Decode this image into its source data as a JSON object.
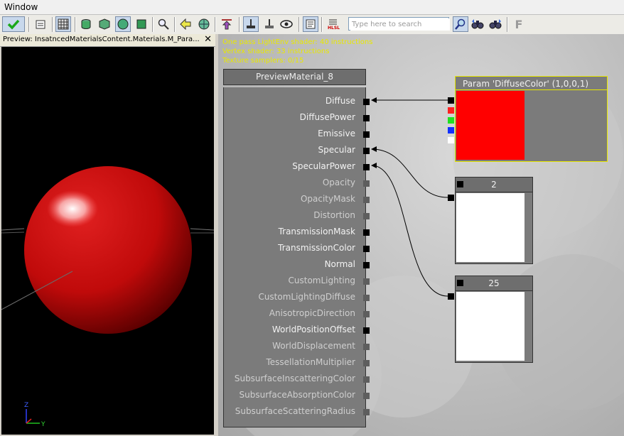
{
  "menubar": {
    "items": [
      "Window"
    ]
  },
  "toolbar": {
    "search_placeholder": "Type here to search",
    "f_label": "F"
  },
  "preview": {
    "title": "Preview: InsatncedMaterialsContent.Materials.M_Para...",
    "close_label": "✕",
    "axis": {
      "z": "Z",
      "y": "Y"
    },
    "sphere_color": "#d01010"
  },
  "graph": {
    "shader_stats": [
      "One pass LightEnv shader: 40 instructions",
      "Vertex shader: 33 instructions",
      "Texture samplers: 0/15"
    ],
    "material_node": {
      "title": "PreviewMaterial_8",
      "inputs": [
        {
          "label": "Diffuse",
          "active": true
        },
        {
          "label": "DiffusePower",
          "active": true
        },
        {
          "label": "Emissive",
          "active": true
        },
        {
          "label": "Specular",
          "active": true
        },
        {
          "label": "SpecularPower",
          "active": true
        },
        {
          "label": "Opacity",
          "active": false
        },
        {
          "label": "OpacityMask",
          "active": false
        },
        {
          "label": "Distortion",
          "active": false
        },
        {
          "label": "TransmissionMask",
          "active": true
        },
        {
          "label": "TransmissionColor",
          "active": true
        },
        {
          "label": "Normal",
          "active": true
        },
        {
          "label": "CustomLighting",
          "active": false
        },
        {
          "label": "CustomLightingDiffuse",
          "active": false
        },
        {
          "label": "AnisotropicDirection",
          "active": false
        },
        {
          "label": "WorldPositionOffset",
          "active": true
        },
        {
          "label": "WorldDisplacement",
          "active": false
        },
        {
          "label": "TessellationMultiplier",
          "active": false
        },
        {
          "label": "SubsurfaceInscatteringColor",
          "active": false
        },
        {
          "label": "SubsurfaceAbsorptionColor",
          "active": false
        },
        {
          "label": "SubsurfaceScatteringRadius",
          "active": false
        }
      ]
    },
    "param_node": {
      "title": "Param 'DiffuseColor' (1,0,0,1)",
      "swatch_color": "#ff0000",
      "channel_pins": [
        "#000000",
        "#ff2020",
        "#20e020",
        "#1030ff",
        "#ffffff"
      ]
    },
    "constant_nodes": [
      {
        "value": "2"
      },
      {
        "value": "25"
      }
    ]
  }
}
